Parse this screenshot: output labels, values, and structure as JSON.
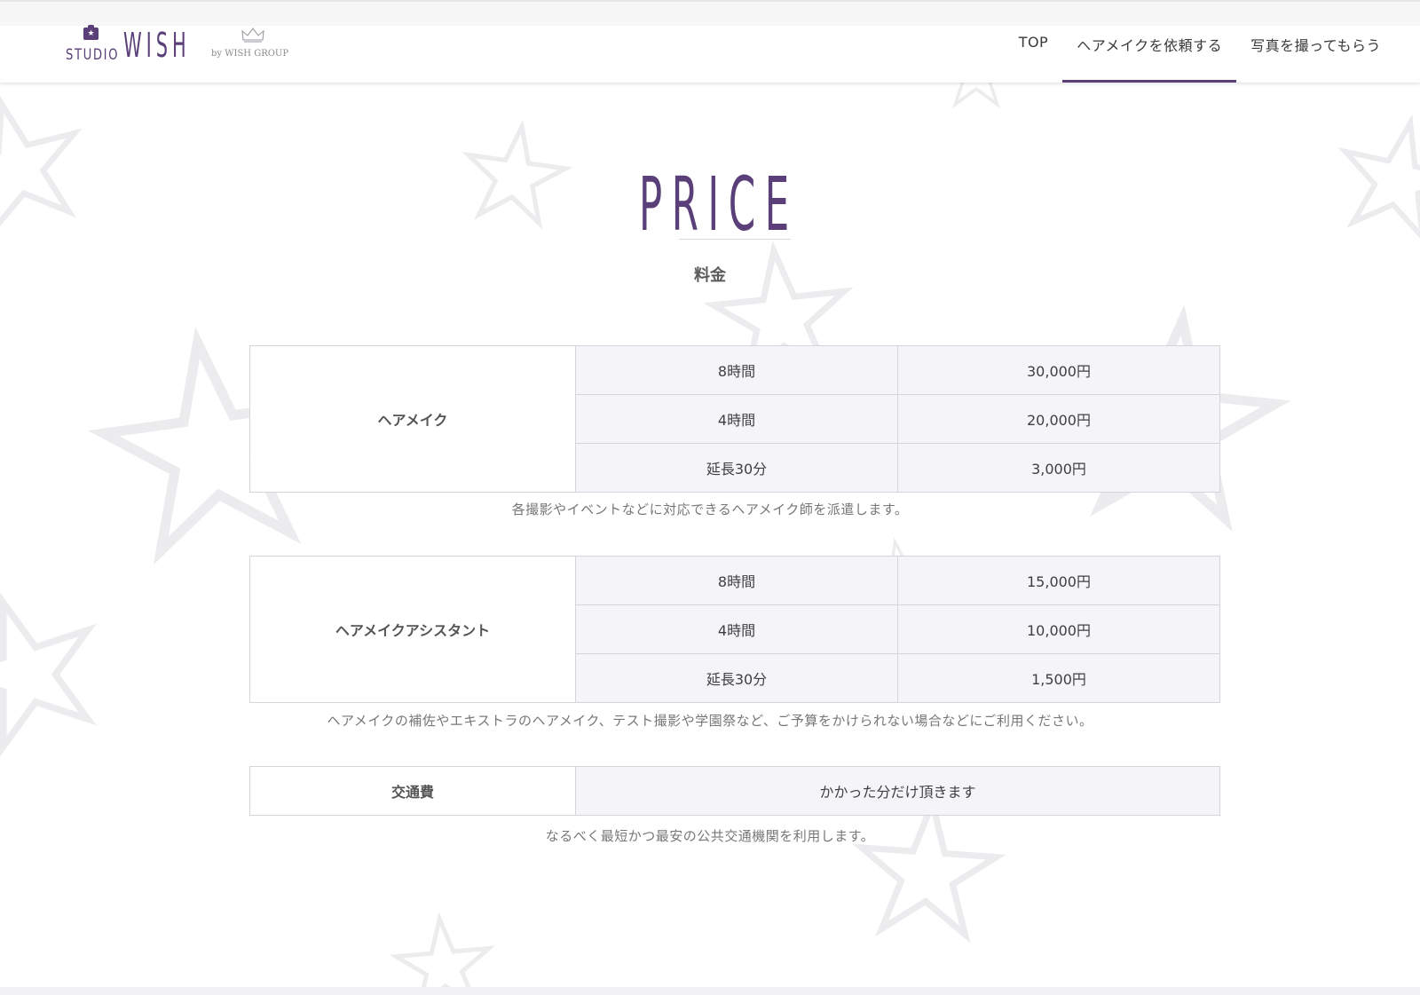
{
  "header": {
    "logo": {
      "studio": "STUDIO",
      "wish": "WISH",
      "by": "by WISH GROUP"
    },
    "nav": [
      {
        "label": "TOP"
      },
      {
        "label": "ヘアメイクを依頼する"
      },
      {
        "label": "写真を撮ってもらう"
      }
    ],
    "active_nav_index": 1
  },
  "main": {
    "title": "PRICE",
    "subtitle": "料金",
    "sections": [
      {
        "heading": "ヘアメイク",
        "rows": [
          {
            "duration": "8時間",
            "price": "30,000円"
          },
          {
            "duration": "4時間",
            "price": "20,000円"
          },
          {
            "duration": "延長30分",
            "price": "3,000円"
          }
        ],
        "note": "各撮影やイベントなどに対応できるヘアメイク師を派遣します。"
      },
      {
        "heading": "ヘアメイクアシスタント",
        "rows": [
          {
            "duration": "8時間",
            "price": "15,000円"
          },
          {
            "duration": "4時間",
            "price": "10,000円"
          },
          {
            "duration": "延長30分",
            "price": "1,500円"
          }
        ],
        "note": "ヘアメイクの補佐やエキストラのヘアメイク、テスト撮影や学園祭など、ご予算をかけられない場合などにご利用ください。"
      },
      {
        "heading": "交通費",
        "value": "かかった分だけ頂きます",
        "note": "なるべく最短かつ最安の公共交通機関を利用します。"
      }
    ]
  },
  "colors": {
    "brand": "#5a3f78",
    "cell_bg": "#f5f4f8",
    "border": "#d6d4d9"
  }
}
